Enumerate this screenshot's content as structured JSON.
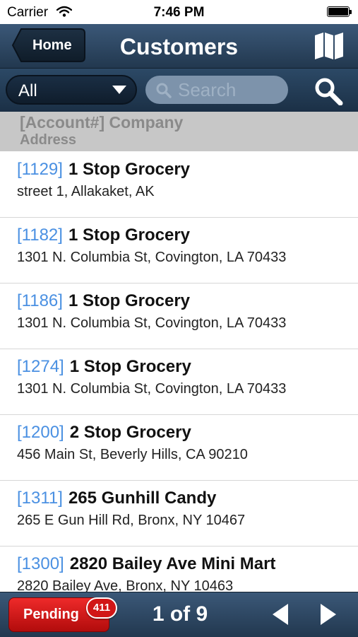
{
  "status_bar": {
    "carrier": "Carrier",
    "time": "7:46 PM"
  },
  "nav": {
    "back_label": "Home",
    "title": "Customers"
  },
  "filter": {
    "selected": "All",
    "search_placeholder": "Search"
  },
  "column_header": {
    "line1": "[Account#] Company",
    "line2": "Address"
  },
  "customers": [
    {
      "account": "[1129]",
      "company": "1 Stop Grocery",
      "address": "street 1, Allakaket, AK"
    },
    {
      "account": "[1182]",
      "company": "1 Stop Grocery",
      "address": "1301 N. Columbia St, Covington, LA 70433"
    },
    {
      "account": "[1186]",
      "company": "1 Stop Grocery",
      "address": "1301 N. Columbia St, Covington, LA 70433"
    },
    {
      "account": "[1274]",
      "company": "1 Stop Grocery",
      "address": "1301 N. Columbia St, Covington, LA 70433"
    },
    {
      "account": "[1200]",
      "company": "2 Stop Grocery",
      "address": "456 Main St, Beverly Hills, CA 90210"
    },
    {
      "account": "[1311]",
      "company": "265 Gunhill Candy",
      "address": "265 E Gun Hill Rd, Bronx, NY 10467"
    },
    {
      "account": "[1300]",
      "company": "2820 Bailey Ave Mini Mart",
      "address": "2820 Bailey Ave, Bronx, NY 10463"
    }
  ],
  "bottom": {
    "pending_label": "Pending",
    "pending_count": "411",
    "page_info": "1 of 9"
  },
  "icons": {
    "wifi": "wifi-icon",
    "battery": "battery-icon",
    "map": "map-icon",
    "dropdown": "chevron-down-icon",
    "search_field": "search-icon",
    "search_button": "search-icon",
    "prev": "triangle-left-icon",
    "next": "triangle-right-icon"
  },
  "colors": {
    "accent_link": "#4a90e2",
    "nav_bar": "#2c4966",
    "pending": "#d11616"
  }
}
